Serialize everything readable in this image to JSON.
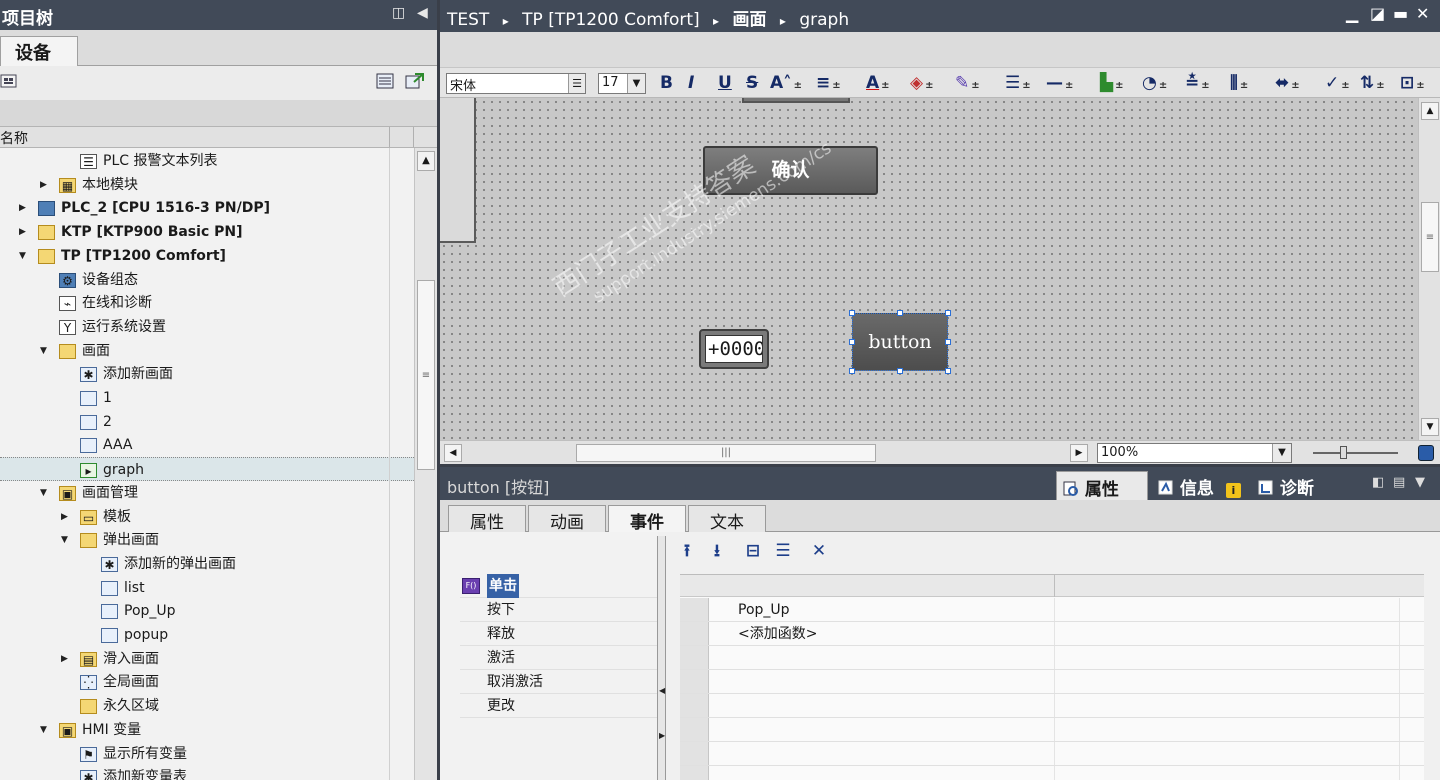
{
  "left_panel": {
    "title": "项目树",
    "collapse_glyph": "◫",
    "arrow_glyph": "◀",
    "tab": "设备",
    "column_name": "名称",
    "tree": [
      {
        "label": "PLC 报警文本列表",
        "depth": 3,
        "expander": "",
        "icon": "alarm-list-icon",
        "bold": false
      },
      {
        "label": "本地模块",
        "depth": 2,
        "expander": "▶",
        "icon": "local-modules-icon",
        "bold": false
      },
      {
        "label": "PLC_2 [CPU 1516-3 PN/DP]",
        "depth": 1,
        "expander": "▶",
        "icon": "plc-device-icon",
        "bold": true
      },
      {
        "label": "KTP [KTP900 Basic PN]",
        "depth": 1,
        "expander": "▶",
        "icon": "hmi-device-icon",
        "bold": true
      },
      {
        "label": "TP [TP1200 Comfort]",
        "depth": 1,
        "expander": "▼",
        "icon": "hmi-device-icon",
        "bold": true
      },
      {
        "label": "设备组态",
        "depth": 2,
        "expander": "",
        "icon": "device-config-icon",
        "bold": false
      },
      {
        "label": "在线和诊断",
        "depth": 2,
        "expander": "",
        "icon": "online-diagnostics-icon",
        "bold": false
      },
      {
        "label": "运行系统设置",
        "depth": 2,
        "expander": "",
        "icon": "runtime-settings-icon",
        "bold": false
      },
      {
        "label": "画面",
        "depth": 2,
        "expander": "▼",
        "icon": "screens-folder-icon",
        "bold": false
      },
      {
        "label": "添加新画面",
        "depth": 3,
        "expander": "",
        "icon": "add-screen-icon",
        "bold": false
      },
      {
        "label": "1",
        "depth": 3,
        "expander": "",
        "icon": "screen-icon",
        "bold": false
      },
      {
        "label": "2",
        "depth": 3,
        "expander": "",
        "icon": "screen-icon",
        "bold": false
      },
      {
        "label": "AAA",
        "depth": 3,
        "expander": "",
        "icon": "screen-icon",
        "bold": false
      },
      {
        "label": "graph",
        "depth": 3,
        "expander": "",
        "icon": "start-screen-icon",
        "bold": false,
        "selected": true
      },
      {
        "label": "画面管理",
        "depth": 2,
        "expander": "▼",
        "icon": "screen-management-icon",
        "bold": false
      },
      {
        "label": "模板",
        "depth": 3,
        "expander": "▶",
        "icon": "templates-folder-icon",
        "bold": false
      },
      {
        "label": "弹出画面",
        "depth": 3,
        "expander": "▼",
        "icon": "popup-folder-icon",
        "bold": false
      },
      {
        "label": "添加新的弹出画面",
        "depth": 4,
        "expander": "",
        "icon": "add-popup-icon",
        "bold": false
      },
      {
        "label": "list",
        "depth": 4,
        "expander": "",
        "icon": "screen-icon",
        "bold": false
      },
      {
        "label": "Pop_Up",
        "depth": 4,
        "expander": "",
        "icon": "screen-icon",
        "bold": false
      },
      {
        "label": "popup",
        "depth": 4,
        "expander": "",
        "icon": "screen-icon",
        "bold": false
      },
      {
        "label": "滑入画面",
        "depth": 3,
        "expander": "▶",
        "icon": "slidein-folder-icon",
        "bold": false
      },
      {
        "label": "全局画面",
        "depth": 3,
        "expander": "",
        "icon": "global-screen-icon",
        "bold": false
      },
      {
        "label": "永久区域",
        "depth": 3,
        "expander": "",
        "icon": "permanent-area-icon",
        "bold": false
      },
      {
        "label": "HMI 变量",
        "depth": 2,
        "expander": "▼",
        "icon": "hmi-tags-folder-icon",
        "bold": false
      },
      {
        "label": "显示所有变量",
        "depth": 3,
        "expander": "",
        "icon": "show-all-tags-icon",
        "bold": false
      },
      {
        "label": "添加新变量表",
        "depth": 3,
        "expander": "",
        "icon": "add-tag-table-icon",
        "bold": false
      }
    ]
  },
  "editor": {
    "breadcrumb": [
      "TEST",
      "TP [TP1200 Comfort]",
      "画面",
      "graph"
    ],
    "breadcrumb_sep": "▸",
    "window_controls": [
      "▁",
      "◪",
      "▬",
      "✕"
    ],
    "font_name": "宋体",
    "font_size": "17",
    "format_buttons": [
      "B",
      "I",
      "U",
      "S",
      "A˄",
      "≡",
      "A",
      "◈",
      "✎",
      "☰",
      "—",
      "▙",
      "◔",
      "≛",
      "⫼",
      "⬌",
      "✓",
      "⇅",
      "⊡"
    ],
    "canvas": {
      "confirm_button": "确认",
      "io_field": "+0000",
      "button": "button",
      "watermark_line1": "西门子工业支持答案",
      "watermark_line2": "support.industry.siemens.com/cs"
    },
    "zoom": "100%"
  },
  "inspector": {
    "object_title": "button [按钮]",
    "top_tabs": [
      "属性",
      "信息",
      "诊断"
    ],
    "tabs": [
      "属性",
      "动画",
      "事件",
      "文本"
    ],
    "active_tab": "事件",
    "events": [
      "单击",
      "按下",
      "释放",
      "激活",
      "取消激活",
      "更改"
    ],
    "active_event": "单击",
    "functions": [
      "Pop_Up",
      "<添加函数>"
    ],
    "toolbar_glyphs": [
      "⭱",
      "⭳",
      "⊟",
      "☰",
      "✕"
    ]
  },
  "colors": {
    "title_bar": "#414a58",
    "selection": "#3762a6",
    "canvas_bg": "#c8c8c8",
    "button_fill": "#5a5a5a"
  }
}
